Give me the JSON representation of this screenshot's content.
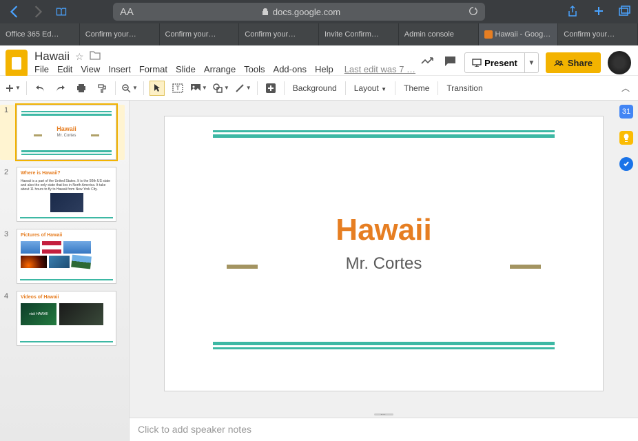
{
  "browser": {
    "url_host": "docs.google.com",
    "tabs": [
      {
        "label": "Office 365 Ed…"
      },
      {
        "label": "Confirm your…"
      },
      {
        "label": "Confirm your…"
      },
      {
        "label": "Confirm your…"
      },
      {
        "label": "Invite Confirm…"
      },
      {
        "label": "Admin console"
      },
      {
        "label": "Hawaii - Goog…",
        "active": true
      },
      {
        "label": "Confirm your…"
      }
    ]
  },
  "doc": {
    "title": "Hawaii",
    "last_edit": "Last edit was 7 …",
    "menu": {
      "file": "File",
      "edit": "Edit",
      "view": "View",
      "insert": "Insert",
      "format": "Format",
      "slide": "Slide",
      "arrange": "Arrange",
      "tools": "Tools",
      "addons": "Add-ons",
      "help": "Help"
    }
  },
  "header_buttons": {
    "present": "Present",
    "share": "Share"
  },
  "toolbar": {
    "background": "Background",
    "layout": "Layout",
    "theme": "Theme",
    "transition": "Transition"
  },
  "filmstrip": [
    {
      "num": "1",
      "title": "Hawaii",
      "subtitle": "Mr. Cortes"
    },
    {
      "num": "2",
      "title": "Where is Hawaii?",
      "body": "Hawaii is a part of the United States. It is the 50th US state and also the only state that lies in North America. It take about 11 hours to fly to Hawaii from New York City."
    },
    {
      "num": "3",
      "title": "Pictures of Hawaii"
    },
    {
      "num": "4",
      "title": "Videos of Hawaii",
      "vid_label": "visit HAWAII"
    }
  ],
  "slide": {
    "title": "Hawaii",
    "subtitle": "Mr. Cortes"
  },
  "notes_placeholder": "Click to add speaker notes",
  "side_panel": {
    "calendar": "31"
  }
}
